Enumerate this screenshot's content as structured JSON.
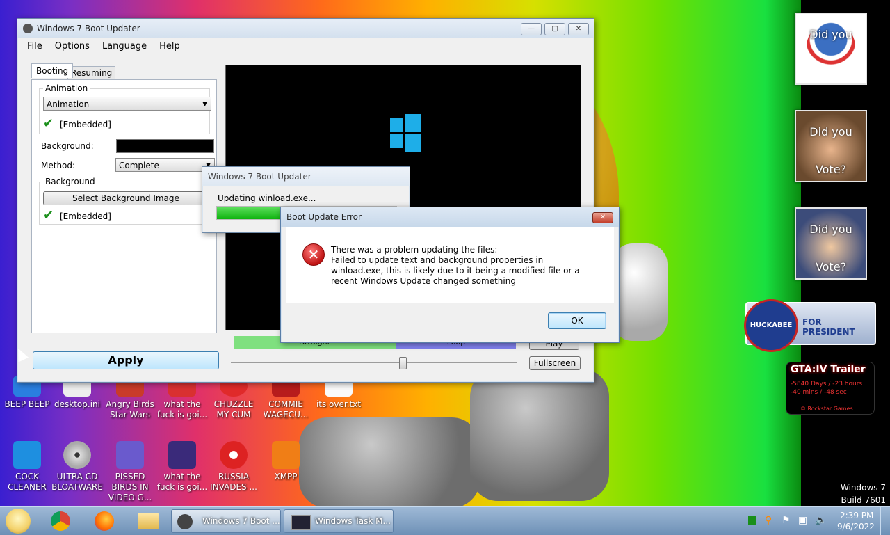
{
  "main_window": {
    "title": "Windows 7 Boot Updater",
    "menu": [
      "File",
      "Options",
      "Language",
      "Help"
    ],
    "tabs": [
      "Booting",
      "Resuming"
    ],
    "animation_group": "Animation",
    "animation_value": "Animation",
    "animation_status": "[Embedded]",
    "background_label": "Background:",
    "method_label": "Method:",
    "method_value": "Complete",
    "background_group": "Background",
    "select_bg_button": "Select Background Image",
    "background_status": "[Embedded]",
    "apply_button": "Apply",
    "seg_left": "Straight",
    "seg_right": "Loop",
    "play_button": "Play",
    "fullscreen_button": "Fullscreen",
    "slider_value": 0.6
  },
  "progress_window": {
    "title": "Windows 7 Boot Updater",
    "status": "Updating winload.exe...",
    "progress": 0.35
  },
  "error_dialog": {
    "title": "Boot Update Error",
    "line1": "There was a problem updating the files:",
    "line2": "Failed to update text and background properties in winload.exe, this is likely due to it being a modified file or a recent Windows Update changed something",
    "ok_button": "OK"
  },
  "desktop": {
    "row1": [
      "BEEP BEEP",
      "desktop.ini",
      "Angry Birds Star Wars",
      "what the fuck is goi...",
      "CHUZZLE MY CUM",
      "COMMIE WAGECU...",
      "its over.txt"
    ],
    "row2": [
      "COCK CLEANER",
      "ULTRA CD BLOATWARE",
      "PISSED BIRDS IN VIDEO G...",
      "what the fuck is goi...",
      "RUSSIA INVADES ...",
      "XMPP"
    ],
    "watermark_line1": "Windows 7",
    "watermark_line2": "Build 7601"
  },
  "gadgets": {
    "g1_text1": "Did you",
    "g2_text1": "Did you",
    "g2_text2": "Vote?",
    "g3_text1": "Did you",
    "g3_text2": "Vote?",
    "huckabee_name": "HUCKABEE",
    "huckabee_tag": "FOR PRESIDENT",
    "gta_title": "GTA:IV Trailer",
    "gta_line1": "-5840 Days / -23 hours",
    "gta_line2": "-40 mins / -48 sec",
    "gta_footer": "© Rockstar Games"
  },
  "taskbar": {
    "items": [
      "Windows 7 Boot ...",
      "Windows Task M..."
    ],
    "time": "2:39 PM",
    "date": "9/6/2022"
  },
  "colors": {
    "win_logo": "#1eaee8",
    "progress_green": "#16c016",
    "error_red": "#d42020"
  }
}
